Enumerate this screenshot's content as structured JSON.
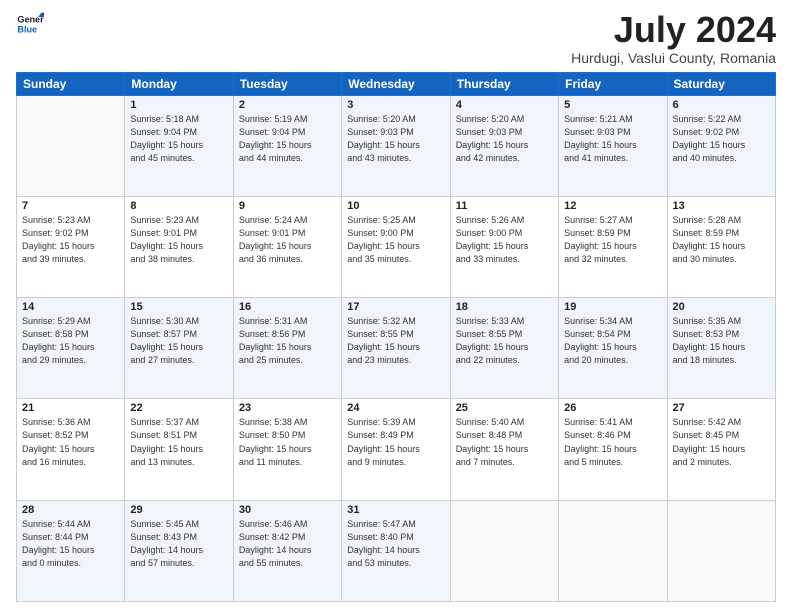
{
  "logo": {
    "line1": "General",
    "line2": "Blue"
  },
  "title": "July 2024",
  "subtitle": "Hurdugi, Vaslui County, Romania",
  "weekdays": [
    "Sunday",
    "Monday",
    "Tuesday",
    "Wednesday",
    "Thursday",
    "Friday",
    "Saturday"
  ],
  "weeks": [
    [
      {
        "day": "",
        "info": ""
      },
      {
        "day": "1",
        "info": "Sunrise: 5:18 AM\nSunset: 9:04 PM\nDaylight: 15 hours\nand 45 minutes."
      },
      {
        "day": "2",
        "info": "Sunrise: 5:19 AM\nSunset: 9:04 PM\nDaylight: 15 hours\nand 44 minutes."
      },
      {
        "day": "3",
        "info": "Sunrise: 5:20 AM\nSunset: 9:03 PM\nDaylight: 15 hours\nand 43 minutes."
      },
      {
        "day": "4",
        "info": "Sunrise: 5:20 AM\nSunset: 9:03 PM\nDaylight: 15 hours\nand 42 minutes."
      },
      {
        "day": "5",
        "info": "Sunrise: 5:21 AM\nSunset: 9:03 PM\nDaylight: 15 hours\nand 41 minutes."
      },
      {
        "day": "6",
        "info": "Sunrise: 5:22 AM\nSunset: 9:02 PM\nDaylight: 15 hours\nand 40 minutes."
      }
    ],
    [
      {
        "day": "7",
        "info": "Sunrise: 5:23 AM\nSunset: 9:02 PM\nDaylight: 15 hours\nand 39 minutes."
      },
      {
        "day": "8",
        "info": "Sunrise: 5:23 AM\nSunset: 9:01 PM\nDaylight: 15 hours\nand 38 minutes."
      },
      {
        "day": "9",
        "info": "Sunrise: 5:24 AM\nSunset: 9:01 PM\nDaylight: 15 hours\nand 36 minutes."
      },
      {
        "day": "10",
        "info": "Sunrise: 5:25 AM\nSunset: 9:00 PM\nDaylight: 15 hours\nand 35 minutes."
      },
      {
        "day": "11",
        "info": "Sunrise: 5:26 AM\nSunset: 9:00 PM\nDaylight: 15 hours\nand 33 minutes."
      },
      {
        "day": "12",
        "info": "Sunrise: 5:27 AM\nSunset: 8:59 PM\nDaylight: 15 hours\nand 32 minutes."
      },
      {
        "day": "13",
        "info": "Sunrise: 5:28 AM\nSunset: 8:59 PM\nDaylight: 15 hours\nand 30 minutes."
      }
    ],
    [
      {
        "day": "14",
        "info": "Sunrise: 5:29 AM\nSunset: 8:58 PM\nDaylight: 15 hours\nand 29 minutes."
      },
      {
        "day": "15",
        "info": "Sunrise: 5:30 AM\nSunset: 8:57 PM\nDaylight: 15 hours\nand 27 minutes."
      },
      {
        "day": "16",
        "info": "Sunrise: 5:31 AM\nSunset: 8:56 PM\nDaylight: 15 hours\nand 25 minutes."
      },
      {
        "day": "17",
        "info": "Sunrise: 5:32 AM\nSunset: 8:55 PM\nDaylight: 15 hours\nand 23 minutes."
      },
      {
        "day": "18",
        "info": "Sunrise: 5:33 AM\nSunset: 8:55 PM\nDaylight: 15 hours\nand 22 minutes."
      },
      {
        "day": "19",
        "info": "Sunrise: 5:34 AM\nSunset: 8:54 PM\nDaylight: 15 hours\nand 20 minutes."
      },
      {
        "day": "20",
        "info": "Sunrise: 5:35 AM\nSunset: 8:53 PM\nDaylight: 15 hours\nand 18 minutes."
      }
    ],
    [
      {
        "day": "21",
        "info": "Sunrise: 5:36 AM\nSunset: 8:52 PM\nDaylight: 15 hours\nand 16 minutes."
      },
      {
        "day": "22",
        "info": "Sunrise: 5:37 AM\nSunset: 8:51 PM\nDaylight: 15 hours\nand 13 minutes."
      },
      {
        "day": "23",
        "info": "Sunrise: 5:38 AM\nSunset: 8:50 PM\nDaylight: 15 hours\nand 11 minutes."
      },
      {
        "day": "24",
        "info": "Sunrise: 5:39 AM\nSunset: 8:49 PM\nDaylight: 15 hours\nand 9 minutes."
      },
      {
        "day": "25",
        "info": "Sunrise: 5:40 AM\nSunset: 8:48 PM\nDaylight: 15 hours\nand 7 minutes."
      },
      {
        "day": "26",
        "info": "Sunrise: 5:41 AM\nSunset: 8:46 PM\nDaylight: 15 hours\nand 5 minutes."
      },
      {
        "day": "27",
        "info": "Sunrise: 5:42 AM\nSunset: 8:45 PM\nDaylight: 15 hours\nand 2 minutes."
      }
    ],
    [
      {
        "day": "28",
        "info": "Sunrise: 5:44 AM\nSunset: 8:44 PM\nDaylight: 15 hours\nand 0 minutes."
      },
      {
        "day": "29",
        "info": "Sunrise: 5:45 AM\nSunset: 8:43 PM\nDaylight: 14 hours\nand 57 minutes."
      },
      {
        "day": "30",
        "info": "Sunrise: 5:46 AM\nSunset: 8:42 PM\nDaylight: 14 hours\nand 55 minutes."
      },
      {
        "day": "31",
        "info": "Sunrise: 5:47 AM\nSunset: 8:40 PM\nDaylight: 14 hours\nand 53 minutes."
      },
      {
        "day": "",
        "info": ""
      },
      {
        "day": "",
        "info": ""
      },
      {
        "day": "",
        "info": ""
      }
    ]
  ]
}
